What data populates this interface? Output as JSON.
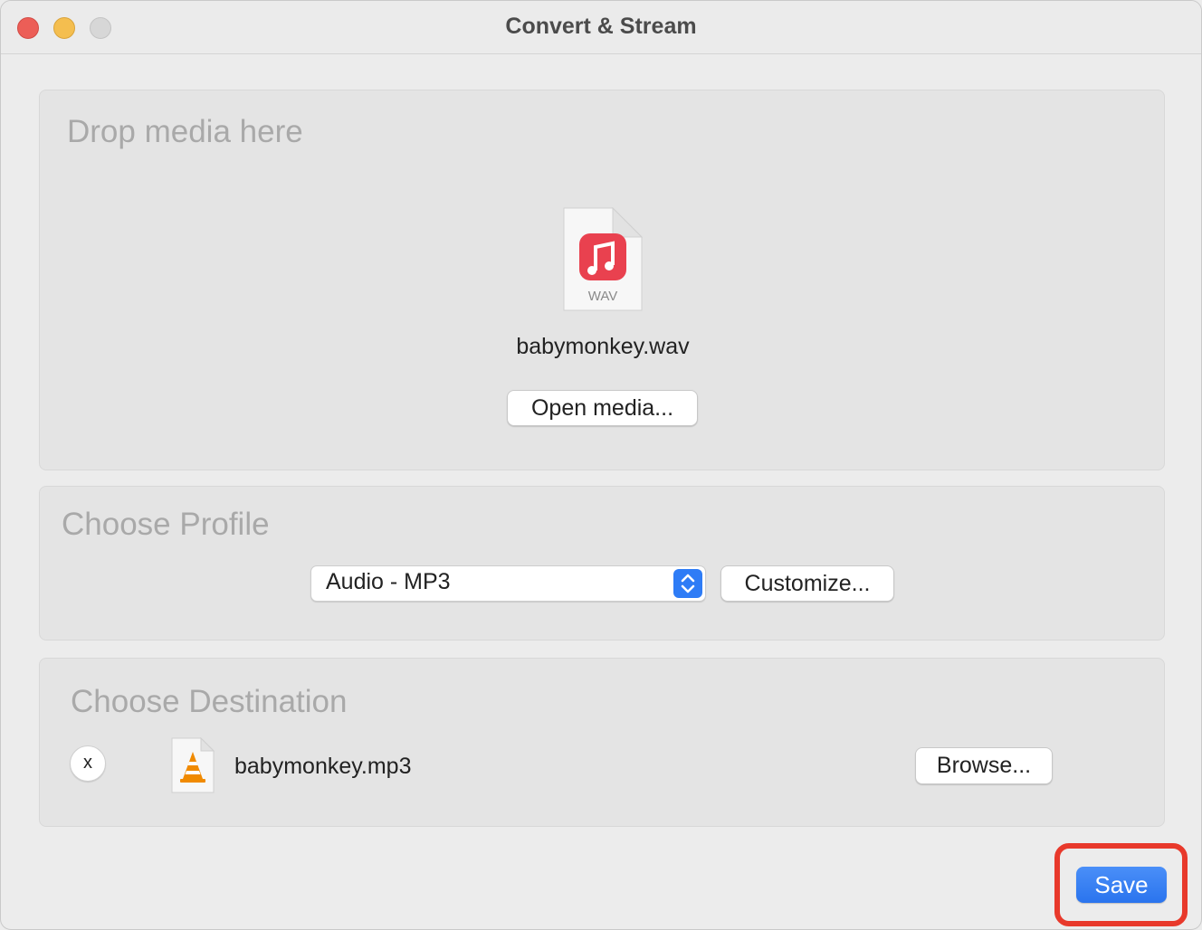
{
  "window": {
    "title": "Convert & Stream"
  },
  "drop_panel": {
    "heading": "Drop media here",
    "file_icon_label": "WAV",
    "file_name": "babymonkey.wav",
    "open_button": "Open media..."
  },
  "profile_panel": {
    "heading": "Choose Profile",
    "selected_profile": "Audio - MP3",
    "customize_button": "Customize..."
  },
  "destination_panel": {
    "heading": "Choose Destination",
    "remove_button": "x",
    "file_name": "babymonkey.mp3",
    "browse_button": "Browse..."
  },
  "footer": {
    "save_button": "Save"
  },
  "colors": {
    "accent": "#2e7cf6",
    "highlight": "#e8392b",
    "music_icon": "#e9414f",
    "vlc_cone": "#f08a00"
  },
  "icons": {
    "wav_file": "music-file-icon",
    "mp3_file": "vlc-cone-icon",
    "stepper": "up-down-chevron-icon"
  }
}
